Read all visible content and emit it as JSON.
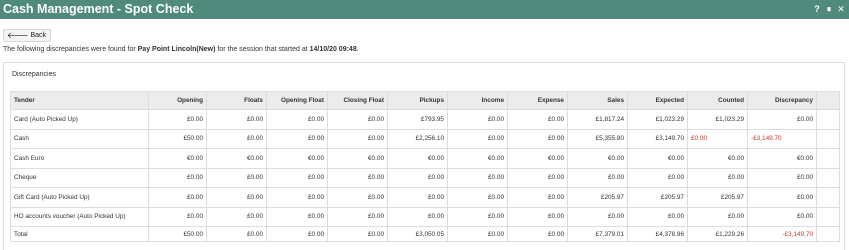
{
  "window": {
    "title": "Cash Management - Spot Check",
    "controls": {
      "help": "?",
      "pause": "⏸",
      "close": "✕"
    }
  },
  "back_button": {
    "label": "Back"
  },
  "message": {
    "prefix": "The following discrepancies were found for ",
    "pay_point": "Pay Point Lincoln(New)",
    "middle": " for the session that started at ",
    "session_start": "14/10/20 09:48",
    "suffix": "."
  },
  "panel": {
    "title": "Discrepancies"
  },
  "colors": {
    "titlebar": "#4f8a7d",
    "negative": "#c0392b",
    "header_bg": "#ececec"
  },
  "table": {
    "columns": [
      "Tender",
      "Opening",
      "Floats",
      "Opening Float",
      "Closing Float",
      "Pickups",
      "Income",
      "Expense",
      "Sales",
      "Expected",
      "Counted",
      "Discrepancy",
      ""
    ],
    "rows": [
      [
        "Card (Auto Picked Up)",
        "£0.00",
        "£0.00",
        "£0.00",
        "£0.00",
        "£793.95",
        "£0.00",
        "£0.00",
        "£1,817.24",
        "£1,023.29",
        "£1,023.29",
        "£0.00",
        ""
      ],
      [
        "Cash",
        "£50.00",
        "£0.00",
        "£0.00",
        "£0.00",
        "£2,256.10",
        "£0.00",
        "£0.00",
        "£5,355.80",
        "£3,149.70",
        "£0.00",
        "-£3,149.70",
        ""
      ],
      [
        "Cash Euro",
        "€0.00",
        "€0.00",
        "€0.00",
        "€0.00",
        "€0.00",
        "€0.00",
        "€0.00",
        "€0.00",
        "€0.00",
        "€0.00",
        "€0.00",
        ""
      ],
      [
        "Cheque",
        "£0.00",
        "£0.00",
        "£0.00",
        "£0.00",
        "£0.00",
        "£0.00",
        "£0.00",
        "£0.00",
        "£0.00",
        "£0.00",
        "£0.00",
        ""
      ],
      [
        "Gift Card (Auto Picked Up)",
        "£0.00",
        "£0.00",
        "£0.00",
        "£0.00",
        "£0.00",
        "£0.00",
        "£0.00",
        "£205.97",
        "£205.97",
        "£205.97",
        "£0.00",
        ""
      ],
      [
        "HO accounts voucher (Auto Picked Up)",
        "£0.00",
        "£0.00",
        "£0.00",
        "£0.00",
        "£0.00",
        "£0.00",
        "£0.00",
        "£0.00",
        "£0.00",
        "£0.00",
        "£0.00",
        ""
      ],
      [
        "Total",
        "£50.00",
        "£0.00",
        "£0.00",
        "£0.00",
        "£3,050.05",
        "£0.00",
        "£0.00",
        "£7,379.01",
        "£4,378.96",
        "£1,229.26",
        "-£3,149.70",
        ""
      ]
    ]
  }
}
